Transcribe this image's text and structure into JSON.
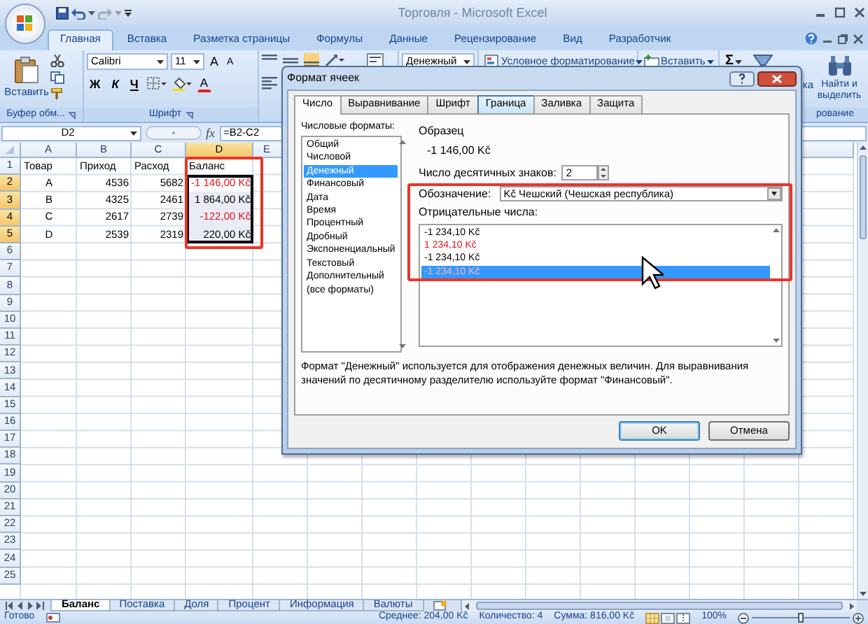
{
  "window": {
    "title": "Торговля - Microsoft Excel"
  },
  "ribbon_tabs": [
    {
      "label": "Главная",
      "selected": true
    },
    {
      "label": "Вставка",
      "selected": false
    },
    {
      "label": "Разметка страницы",
      "selected": false
    },
    {
      "label": "Формулы",
      "selected": false
    },
    {
      "label": "Данные",
      "selected": false
    },
    {
      "label": "Рецензирование",
      "selected": false
    },
    {
      "label": "Вид",
      "selected": false
    },
    {
      "label": "Разработчик",
      "selected": false
    }
  ],
  "ribbon": {
    "paste": "Вставить",
    "clipboard_group": "Буфер обм...",
    "font_name": "Calibri",
    "font_size": "11",
    "grow_font": "A",
    "shrink_font": "A",
    "bold": "Ж",
    "italic": "К",
    "underline": "Ч",
    "font_color": "A",
    "font_group": "Шрифт",
    "number_format": "Денежный",
    "conditional_formatting": "Условное форматирование",
    "insert_cells": "Вставить",
    "autosum": "Σ",
    "sort_filter": "ка",
    "find_select": "Найти и выделить",
    "editing_group": "рование"
  },
  "formula_bar": {
    "name_box": "D2",
    "function_label": "fx",
    "formula": "=B2-C2"
  },
  "sheet": {
    "columns": [
      {
        "label": "A",
        "selected": false
      },
      {
        "label": "B",
        "selected": false
      },
      {
        "label": "C",
        "selected": false
      },
      {
        "label": "D",
        "selected": true
      },
      {
        "label": "E",
        "selected": false
      }
    ],
    "rows": [
      {
        "number": "1",
        "selected": false,
        "cells": [
          {
            "text": "Товар",
            "kind": "text"
          },
          {
            "text": "Приход",
            "kind": "text"
          },
          {
            "text": "Расход",
            "kind": "text"
          },
          {
            "text": "Баланс",
            "kind": "text"
          }
        ]
      },
      {
        "number": "2",
        "selected": true,
        "cells": [
          {
            "text": "A",
            "kind": "centered"
          },
          {
            "text": "4536",
            "kind": "number"
          },
          {
            "text": "5682",
            "kind": "number"
          },
          {
            "text": "-1 146,00 Kč",
            "kind": "number",
            "negative": true,
            "selected": true
          }
        ]
      },
      {
        "number": "3",
        "selected": true,
        "cells": [
          {
            "text": "B",
            "kind": "centered"
          },
          {
            "text": "4325",
            "kind": "number"
          },
          {
            "text": "2461",
            "kind": "number"
          },
          {
            "text": "1 864,00 Kč",
            "kind": "number",
            "negative": false,
            "selected": true
          }
        ]
      },
      {
        "number": "4",
        "selected": true,
        "cells": [
          {
            "text": "C",
            "kind": "centered"
          },
          {
            "text": "2617",
            "kind": "number"
          },
          {
            "text": "2739",
            "kind": "number"
          },
          {
            "text": "-122,00 Kč",
            "kind": "number",
            "negative": true,
            "selected": true
          }
        ]
      },
      {
        "number": "5",
        "selected": true,
        "cells": [
          {
            "text": "D",
            "kind": "centered"
          },
          {
            "text": "2539",
            "kind": "number"
          },
          {
            "text": "2319",
            "kind": "number"
          },
          {
            "text": "220,00 Kč",
            "kind": "number",
            "negative": false,
            "selected": true
          }
        ]
      },
      {
        "number": "6",
        "selected": false
      },
      {
        "number": "7",
        "selected": false
      },
      {
        "number": "8",
        "selected": false
      },
      {
        "number": "9",
        "selected": false
      },
      {
        "number": "10",
        "selected": false
      },
      {
        "number": "11",
        "selected": false
      },
      {
        "number": "12",
        "selected": false
      },
      {
        "number": "13",
        "selected": false
      },
      {
        "number": "14",
        "selected": false
      },
      {
        "number": "15",
        "selected": false
      },
      {
        "number": "16",
        "selected": false
      },
      {
        "number": "17",
        "selected": false
      },
      {
        "number": "18",
        "selected": false
      },
      {
        "number": "19",
        "selected": false
      },
      {
        "number": "20",
        "selected": false
      },
      {
        "number": "21",
        "selected": false
      },
      {
        "number": "22",
        "selected": false
      },
      {
        "number": "23",
        "selected": false
      },
      {
        "number": "24",
        "selected": false
      },
      {
        "number": "25",
        "selected": false
      }
    ]
  },
  "sheet_tabs": [
    {
      "label": "Баланс",
      "selected": true
    },
    {
      "label": "Поставка",
      "selected": false
    },
    {
      "label": "Доля",
      "selected": false
    },
    {
      "label": "Процент",
      "selected": false
    },
    {
      "label": "Информация",
      "selected": false
    },
    {
      "label": "Валюты",
      "selected": false
    }
  ],
  "status_bar": {
    "mode": "Готово",
    "average": "Среднее: 204,00 Kč",
    "count": "Количество: 4",
    "sum": "Сумма: 816,00 Kč",
    "zoom": "100%",
    "zoom_slider": {
      "level": 0.5
    }
  },
  "dialog": {
    "title": "Формат ячеек",
    "tabs": [
      {
        "label": "Число",
        "selected": true,
        "hovered": false
      },
      {
        "label": "Выравнивание",
        "selected": false,
        "hovered": false
      },
      {
        "label": "Шрифт",
        "selected": false,
        "hovered": false
      },
      {
        "label": "Граница",
        "selected": false,
        "hovered": true
      },
      {
        "label": "Заливка",
        "selected": false,
        "hovered": false
      },
      {
        "label": "Защита",
        "selected": false,
        "hovered": false
      }
    ],
    "formats_label": "Числовые форматы:",
    "formats": [
      {
        "label": "Общий",
        "selected": false
      },
      {
        "label": "Числовой",
        "selected": false
      },
      {
        "label": "Денежный",
        "selected": true
      },
      {
        "label": "Финансовый",
        "selected": false
      },
      {
        "label": "Дата",
        "selected": false
      },
      {
        "label": "Время",
        "selected": false
      },
      {
        "label": "Процентный",
        "selected": false
      },
      {
        "label": "Дробный",
        "selected": false
      },
      {
        "label": "Экспоненциальный",
        "selected": false
      },
      {
        "label": "Текстовый",
        "selected": false
      },
      {
        "label": "Дополнительный",
        "selected": false
      },
      {
        "label": "(все форматы)",
        "selected": false
      }
    ],
    "sample_label": "Образец",
    "sample": "-1 146,00 Kč",
    "decimals_label": "Число десятичных знаков:",
    "decimals": "2",
    "symbol_label": "Обозначение:",
    "symbol": "Kč Чешский (Чешская республика)",
    "negative_label": "Отрицательные числа:",
    "negative_formats": [
      {
        "text": "-1 234,10 Kč",
        "negative": false,
        "selected": false
      },
      {
        "text": "1 234,10 Kč",
        "negative": true,
        "selected": false
      },
      {
        "text": "-1 234,10 Kč",
        "negative": false,
        "selected": false
      },
      {
        "text": "-1 234,10 Kč",
        "negative": true,
        "selected": true
      }
    ],
    "description": "Формат \"Денежный\" используется для отображения денежных величин. Для выравнивания значений по десятичному разделителю используйте формат \"Финансовый\".",
    "buttons": [
      {
        "label": "OK",
        "default": true
      },
      {
        "label": "Отмена",
        "default": false
      }
    ]
  }
}
